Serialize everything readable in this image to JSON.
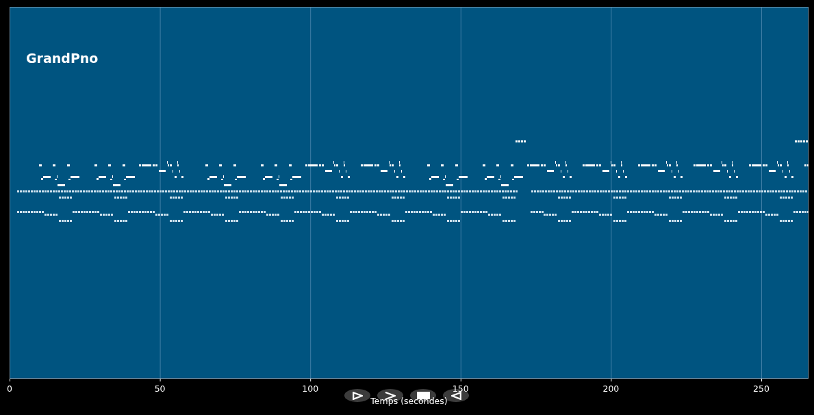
{
  "chart": {
    "title": "GrandPno"
  },
  "x_axis": {
    "ticks": [
      "0",
      "50",
      "100",
      "150",
      "200",
      "250"
    ],
    "label": "Temps (secondes)"
  },
  "playback_buttons": [
    {
      "kind": "play"
    },
    {
      "kind": "step"
    },
    {
      "kind": "stop"
    },
    {
      "kind": "reverse"
    }
  ]
}
